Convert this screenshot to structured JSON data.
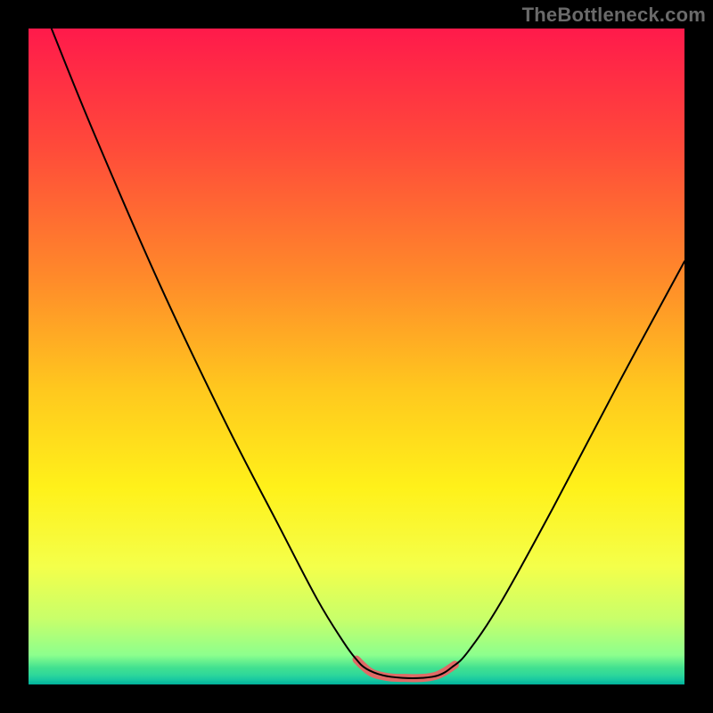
{
  "watermark": "TheBottleneck.com",
  "chart_data": {
    "type": "line",
    "title": "",
    "xlabel": "",
    "ylabel": "",
    "xlim": [
      0,
      100
    ],
    "ylim": [
      0,
      100
    ],
    "background_gradient": {
      "stops": [
        {
          "offset": 0.0,
          "color": "#ff1a4b"
        },
        {
          "offset": 0.18,
          "color": "#ff4a3a"
        },
        {
          "offset": 0.38,
          "color": "#ff8a2a"
        },
        {
          "offset": 0.55,
          "color": "#ffc81e"
        },
        {
          "offset": 0.7,
          "color": "#fff11a"
        },
        {
          "offset": 0.82,
          "color": "#f4ff4a"
        },
        {
          "offset": 0.9,
          "color": "#c8ff6a"
        },
        {
          "offset": 0.955,
          "color": "#8dff8d"
        },
        {
          "offset": 0.975,
          "color": "#40e090"
        },
        {
          "offset": 0.985,
          "color": "#2fd89a"
        },
        {
          "offset": 0.993,
          "color": "#18c8a0"
        },
        {
          "offset": 1.0,
          "color": "#00b09b"
        }
      ]
    },
    "series": [
      {
        "name": "bottleneck-curve",
        "color": "#000000",
        "width": 2,
        "points": [
          {
            "x": 3.5,
            "y": 100.0
          },
          {
            "x": 10.0,
            "y": 84.0
          },
          {
            "x": 20.0,
            "y": 61.0
          },
          {
            "x": 30.0,
            "y": 40.0
          },
          {
            "x": 38.0,
            "y": 24.5
          },
          {
            "x": 44.0,
            "y": 13.0
          },
          {
            "x": 48.0,
            "y": 6.5
          },
          {
            "x": 50.0,
            "y": 3.8
          },
          {
            "x": 51.5,
            "y": 2.4
          },
          {
            "x": 54.0,
            "y": 1.4
          },
          {
            "x": 57.0,
            "y": 1.0
          },
          {
            "x": 60.0,
            "y": 1.0
          },
          {
            "x": 62.5,
            "y": 1.4
          },
          {
            "x": 64.5,
            "y": 2.6
          },
          {
            "x": 67.0,
            "y": 5.0
          },
          {
            "x": 72.0,
            "y": 12.5
          },
          {
            "x": 80.0,
            "y": 27.0
          },
          {
            "x": 90.0,
            "y": 46.0
          },
          {
            "x": 100.0,
            "y": 64.5
          }
        ]
      },
      {
        "name": "valley-highlight",
        "color": "#e06a66",
        "width": 9,
        "points": [
          {
            "x": 50.0,
            "y": 3.8
          },
          {
            "x": 51.0,
            "y": 2.8
          },
          {
            "x": 52.5,
            "y": 1.7
          },
          {
            "x": 55.0,
            "y": 1.1
          },
          {
            "x": 57.5,
            "y": 1.0
          },
          {
            "x": 60.0,
            "y": 1.0
          },
          {
            "x": 62.0,
            "y": 1.3
          },
          {
            "x": 63.5,
            "y": 2.0
          },
          {
            "x": 65.0,
            "y": 3.0
          }
        ]
      }
    ]
  }
}
